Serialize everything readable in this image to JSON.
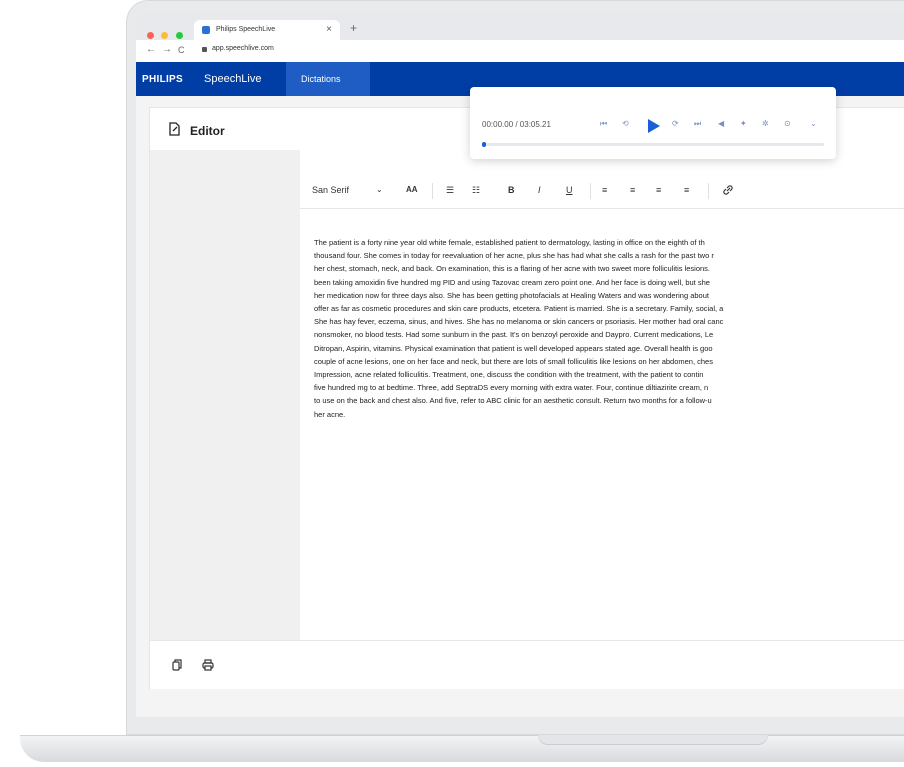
{
  "browser": {
    "tab_title": "Philips SpeechLive",
    "tab_close": "×",
    "new_tab": "+",
    "url": "app.speechlive.com",
    "nav": {
      "back": "←",
      "forward": "→",
      "reload": "C"
    }
  },
  "app": {
    "brand": "PHILIPS",
    "product": "SpeechLive",
    "nav_tab": "Dictations"
  },
  "editor": {
    "title": "Editor",
    "toolbar": {
      "font": "San Serif",
      "size": "AA",
      "bold": "B",
      "italic": "I",
      "underline": "U"
    },
    "text": "The patient is a forty nine year old white female, established patient to dermatology, lasting in office on the eighth of th\nthousand four. She comes in today for reevaluation of her acne, plus she has had what she calls a rash for the past two r\nher chest, stomach, neck, and back. On examination, this is a flaring of her acne with two sweet more folliculitis lesions.\nbeen taking amoxidin five hundred mg PID and using Tazovac cream zero point one. And her face is doing well, but she\nher medication now for three days also. She has been getting photofacials at Healing Waters and was wondering about\noffer as far as cosmetic procedures and skin care products, etcetera. Patient is married. She is a secretary. Family, social, a\nShe has hay fever, eczema, sinus, and hives. She has no melanoma or skin cancers or psoriasis. Her mother had oral canc\nnonsmoker, no blood tests. Had some sunburn in the past. It's on benzoyl peroxide and Daypro. Current medications, Le\nDitropan, Aspirin, vitamins. Physical examination that patient is well developed appears stated age. Overall health is goo\ncouple of acne lesions, one on her face and neck, but there are lots of small folliculitis like lesions on her abdomen, ches\nImpression, acne related folliculitis. Treatment, one, discuss the condition with the treatment, with the patient to contin\nfive hundred mg to at bedtime. Three, add SeptraDS every morning with extra water. Four, continue diltiazirite cream, n\nto use on the back and chest also. And five, refer to ABC clinic for an aesthetic consult. Return two months for a follow-u\nher acne."
  },
  "player": {
    "time": "00:00.00 / 03:05.21",
    "progress_fraction": 0.01,
    "icons": [
      "skip-back-icon",
      "rewind-icon",
      "play-icon",
      "forward-icon",
      "skip-end-icon",
      "volume-icon",
      "marker-icon",
      "speed-icon",
      "settings-icon",
      "expand-icon"
    ]
  },
  "colors": {
    "brand_blue": "#003da5",
    "accent_blue": "#1a5fd6"
  }
}
